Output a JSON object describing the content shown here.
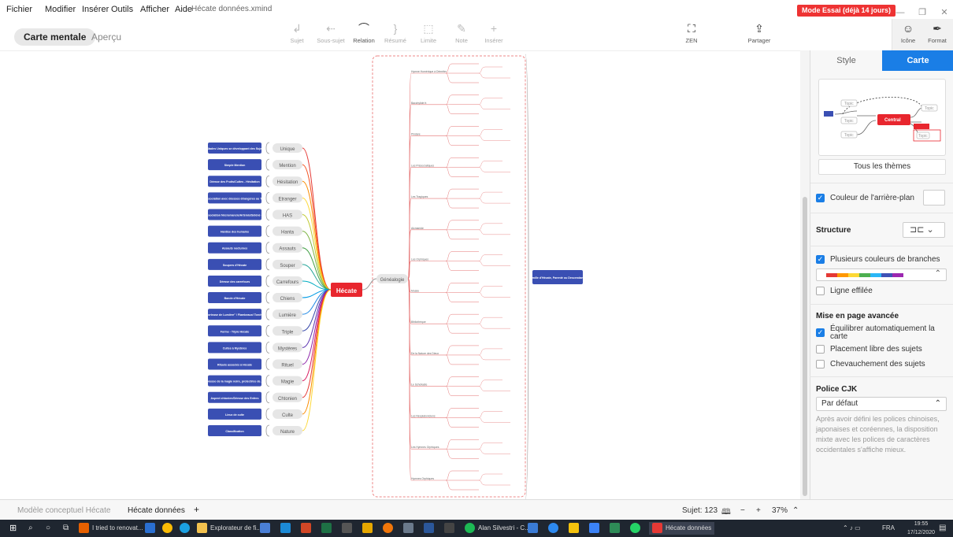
{
  "menubar": {
    "items": [
      "Fichier",
      "Modifier",
      "Insérer",
      "Outils",
      "Afficher",
      "Aide"
    ],
    "file_name": "Hécate données.xmind",
    "trial_badge": "Mode Essai (déjà 14 jours)"
  },
  "toolbar": {
    "view_tabs": [
      "Carte mentale",
      "Aperçu"
    ],
    "tools": [
      {
        "label": "Sujet",
        "icon": "subtopic-icon",
        "enabled": false
      },
      {
        "label": "Sous-sujet",
        "icon": "child-topic-icon",
        "enabled": false
      },
      {
        "label": "Relation",
        "icon": "relationship-icon",
        "enabled": true
      },
      {
        "label": "Résumé",
        "icon": "summary-icon",
        "enabled": false
      },
      {
        "label": "Limite",
        "icon": "boundary-icon",
        "enabled": false
      },
      {
        "label": "Note",
        "icon": "note-icon",
        "enabled": false
      },
      {
        "label": "Insérer",
        "icon": "insert-icon",
        "enabled": false
      }
    ],
    "zen_label": "ZEN",
    "share_label": "Partager",
    "icon_label": "Icône",
    "format_label": "Format"
  },
  "mindmap": {
    "central": "Hécate",
    "left_branches": [
      {
        "label": "Unique",
        "detail": "Stades Uniques se développant des Sujet"
      },
      {
        "label": "Mention",
        "detail": "Simple Mention"
      },
      {
        "label": "Hésitation",
        "detail": "Déesse des Fruits/Cultes - Hésitation"
      },
      {
        "label": "Etranger",
        "detail": "Association avec déesses étrangères ou Tri-Visuel/Déesses(Perséphone)"
      },
      {
        "label": "HAS",
        "detail": "Association Nécromancie/Artémis/Séléné - Tri-Lunaire"
      },
      {
        "label": "Hanta",
        "detail": "Hantise des humains"
      },
      {
        "label": "Assauts",
        "detail": "Assauts nocturnes"
      },
      {
        "label": "Souper",
        "detail": "Soupers d'Hécate"
      },
      {
        "label": "Carrefours",
        "detail": "Déesse des carrefours"
      },
      {
        "label": "Chiens",
        "detail": "Bande d'Hécate"
      },
      {
        "label": "Lumière",
        "detail": "\"Porteuse de Lumière\" / Flambeaux/ Torches"
      },
      {
        "label": "Triple",
        "detail": "Forme - Triple Hécate"
      },
      {
        "label": "Mystères",
        "detail": "Cultes à Mystères"
      },
      {
        "label": "Rituel",
        "detail": "Rituels associés à Hécate"
      },
      {
        "label": "Magie",
        "detail": "Déesse de la magie noire, protectrice des sorcier(e)s"
      },
      {
        "label": "Chtonien",
        "detail": "Aspect chtonien/Déesse des Enfers"
      },
      {
        "label": "Culte",
        "detail": "Lieux de culte"
      },
      {
        "label": "Nature",
        "detail": "Classification"
      }
    ],
    "genealogy_label": "Généalogie",
    "genealogy_root": "Famille d'Hécate, Parenté ou Descendance",
    "genealogy_entries": [
      "Hymne Homérique à Déméter",
      "Bacchylide fr.",
      "Pindare",
      "Les Présocratiques",
      "Les Tragiques",
      "Alcmanide",
      "Les Orphiques",
      "Musée",
      "Bibliothèque",
      "De la Nature des Dieux",
      "Le Scholiaste",
      "Les Néoplatoniciens",
      "Les Hymnes Orphiques",
      "Hymnes Orphiques"
    ]
  },
  "panel": {
    "tab_style": "Style",
    "tab_map": "Carte",
    "thumb_central": "Central",
    "thumb_topic": "Topic",
    "all_themes": "Tous les thèmes",
    "bg_color": "Couleur de l'arrière-plan",
    "structure": "Structure",
    "multi_colors": "Plusieurs couleurs de branches",
    "tapered": "Ligne effilée",
    "advanced": "Mise en page avancée",
    "auto_balance": "Équilibrer automatiquement la carte",
    "free_placement": "Placement libre des sujets",
    "overlap": "Chevauchement des sujets",
    "cjk_font": "Police CJK",
    "cjk_default": "Par défaut",
    "cjk_desc": "Après avoir défini les polices chinoises, japonaises et coréennes, la disposition mixte avec les polices de caractères occidentales s'affiche mieux.",
    "rainbow": [
      "#e53935",
      "#ff9800",
      "#fdd835",
      "#4caf50",
      "#29b6f6",
      "#3f51b5",
      "#9c27b0"
    ]
  },
  "bottombar": {
    "sheets": [
      "Modèle conceptuel Hécate",
      "Hécate données"
    ],
    "add_sheet": "+",
    "topic_count": "Sujet: 123",
    "zoom": "37%"
  },
  "taskbar": {
    "items": [
      "I tried to renovat...",
      "Explorateur de fi...",
      "Alan Silvestri - C...",
      "Hécate données"
    ],
    "lang": "FRA",
    "time": "19:55",
    "date": "17/12/2020"
  }
}
